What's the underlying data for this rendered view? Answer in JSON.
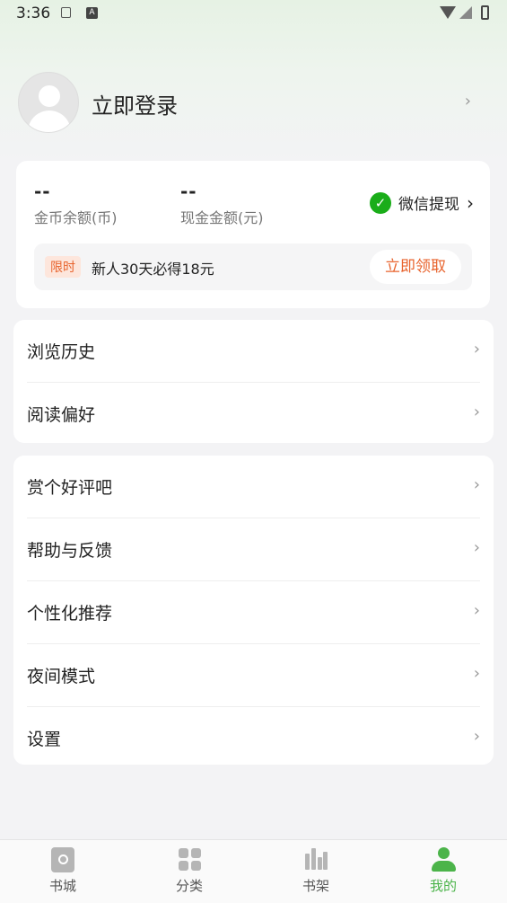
{
  "status_bar": {
    "time": "3:36",
    "a_icon_letter": "A"
  },
  "profile": {
    "login_label": "立即登录"
  },
  "wallet": {
    "coin_value": "--",
    "coin_label": "金币余额(币)",
    "cash_value": "--",
    "cash_label": "现金金额(元)",
    "withdraw_label": "微信提现",
    "promo_tag": "限时",
    "promo_text": "新人30天必得18元",
    "claim_label": "立即领取"
  },
  "menu_group_1": [
    {
      "label": "浏览历史"
    },
    {
      "label": "阅读偏好"
    }
  ],
  "menu_group_2": [
    {
      "label": "赏个好评吧"
    },
    {
      "label": "帮助与反馈"
    },
    {
      "label": "个性化推荐"
    },
    {
      "label": "夜间模式"
    },
    {
      "label": "设置"
    }
  ],
  "tabbar": {
    "tabs": [
      {
        "label": "书城",
        "icon": "bookstore-icon"
      },
      {
        "label": "分类",
        "icon": "category-icon"
      },
      {
        "label": "书架",
        "icon": "bookshelf-icon"
      },
      {
        "label": "我的",
        "icon": "profile-icon"
      }
    ],
    "active_index": 3,
    "active_color": "#4cb44a"
  },
  "colors": {
    "accent_green": "#4cb44a",
    "promo_orange": "#e8632d",
    "wechat_green": "#1aad19"
  }
}
